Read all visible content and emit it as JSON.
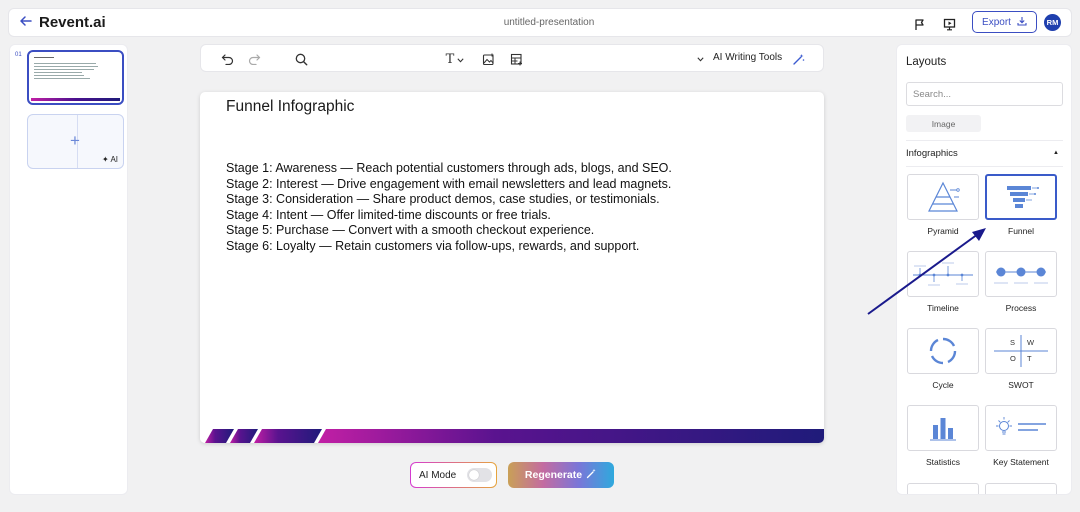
{
  "header": {
    "brand": "Revent.ai",
    "doc_title": "untitled-presentation",
    "export_label": "Export",
    "avatar_initials": "RM",
    "icons": [
      "back-arrow-icon",
      "flag-icon",
      "present-icon",
      "download-icon"
    ]
  },
  "slides_panel": {
    "slide_number": "01",
    "add_label": "AI"
  },
  "toolbar": {
    "ai_writing_tools": "AI Writing Tools",
    "icons": [
      "undo-icon",
      "redo-icon",
      "search-icon",
      "text-icon",
      "chevron-down-icon",
      "image-icon",
      "table-icon",
      "chevron-down-icon",
      "magic-wand-icon"
    ]
  },
  "slide": {
    "title": "Funnel Infographic",
    "stages": [
      "Stage 1: Awareness — Reach potential customers through ads, blogs, and SEO.",
      "Stage 2: Interest — Drive engagement with email newsletters and lead magnets.",
      "Stage 3: Consideration — Share product demos, case studies, or testimonials.",
      "Stage 4: Intent — Offer limited-time discounts or free trials.",
      "Stage 5: Purchase — Convert with a smooth checkout experience.",
      "Stage 6: Loyalty — Retain customers via follow-ups, rewards, and support."
    ]
  },
  "controls": {
    "ai_mode_label": "AI Mode",
    "ai_mode_on": false,
    "regenerate_label": "Regenerate"
  },
  "layouts": {
    "title": "Layouts",
    "search_placeholder": "Search...",
    "filter_label": "Image",
    "section_label": "Infographics",
    "selected": "Funnel",
    "items": [
      {
        "label": "Pyramid",
        "icon": "pyramid-icon"
      },
      {
        "label": "Funnel",
        "icon": "funnel-icon"
      },
      {
        "label": "Timeline",
        "icon": "timeline-icon"
      },
      {
        "label": "Process",
        "icon": "process-icon"
      },
      {
        "label": "Cycle",
        "icon": "cycle-icon"
      },
      {
        "label": "SWOT",
        "icon": "swot-icon"
      },
      {
        "label": "Statistics",
        "icon": "statistics-icon"
      },
      {
        "label": "Key Statement",
        "icon": "key-statement-icon"
      }
    ],
    "swot_letters": [
      "S",
      "W",
      "O",
      "T"
    ]
  },
  "colors": {
    "accent": "#3b4ec2",
    "annotation_arrow": "#1a1a8c",
    "icon_blue": "#5b86d6",
    "footer_gradient": [
      "#c21fa5",
      "#4a118e",
      "#1f1b7a"
    ]
  }
}
